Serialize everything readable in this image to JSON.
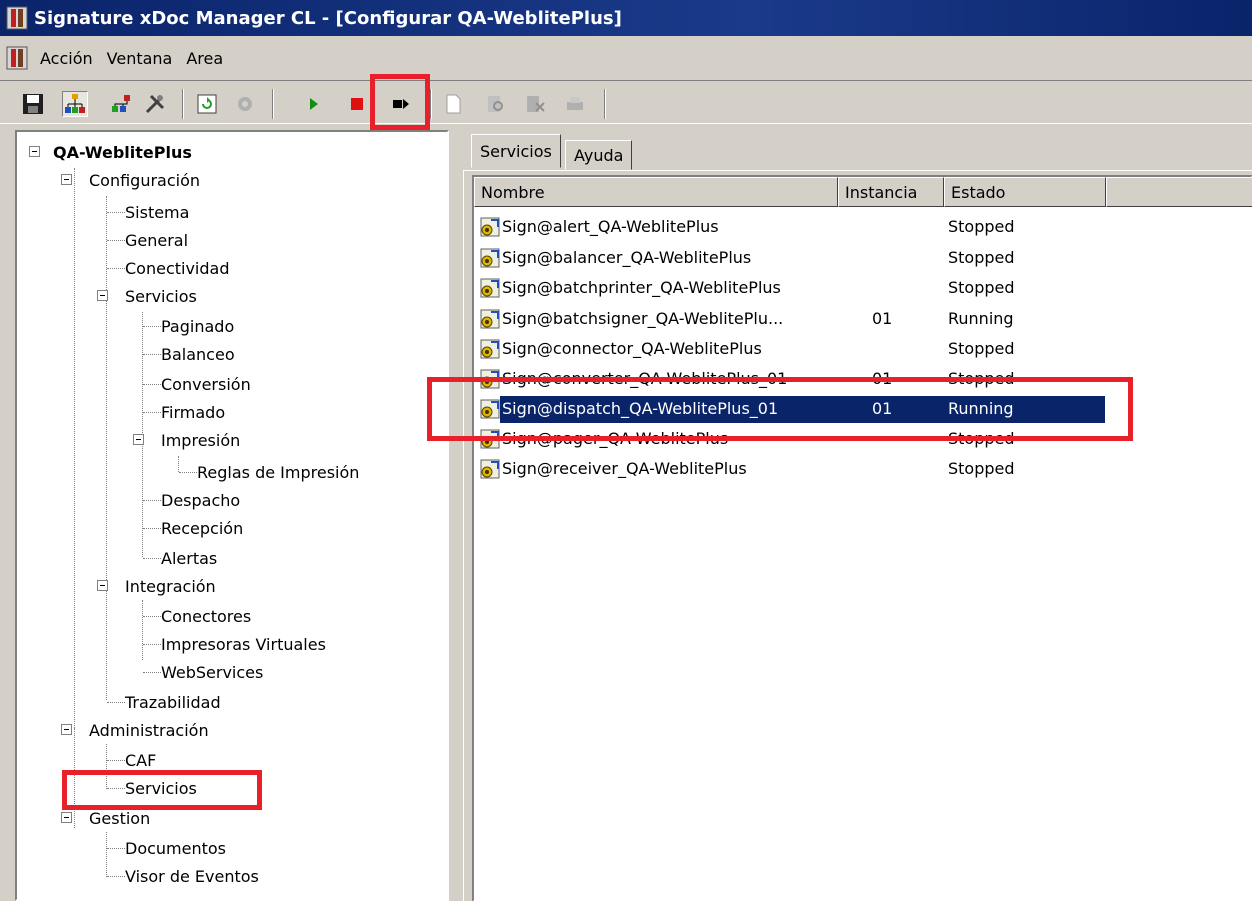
{
  "window": {
    "title": "Signature xDoc Manager CL - [Configurar QA-WeblitePlus]"
  },
  "menu": {
    "items": [
      "Acción",
      "Ventana",
      "Area"
    ]
  },
  "toolbar": {
    "buttons": [
      "save-icon",
      "config-tree-icon",
      "network-icon",
      "tools-icon",
      "refresh-icon",
      "gear-disabled-icon",
      "play-icon",
      "stop-icon",
      "stop-next-icon",
      "new-doc-icon",
      "doc-search-icon",
      "doc-flag-icon",
      "printer-icon"
    ]
  },
  "tree": {
    "root": "QA-WeblitePlus",
    "configuracion": "Configuración",
    "sistema": "Sistema",
    "general": "General",
    "conectividad": "Conectividad",
    "servicios": "Servicios",
    "paginado": "Paginado",
    "balanceo": "Balanceo",
    "conversion": "Conversión",
    "firmado": "Firmado",
    "impresion": "Impresión",
    "reglas": "Reglas de Impresión",
    "despacho": "Despacho",
    "recepcion": "Recepción",
    "alertas": "Alertas",
    "integracion": "Integración",
    "conectores": "Conectores",
    "impresoras": "Impresoras Virtuales",
    "webservices": "WebServices",
    "trazabilidad": "Trazabilidad",
    "administracion": "Administración",
    "caf": "CAF",
    "admin_servicios": "Servicios",
    "gestion": "Gestion",
    "documentos": "Documentos",
    "visor": "Visor de Eventos"
  },
  "tabs": {
    "servicios": "Servicios",
    "ayuda": "Ayuda"
  },
  "list": {
    "columns": {
      "nombre": "Nombre",
      "instancia": "Instancia",
      "estado": "Estado"
    },
    "rows": [
      {
        "name": "Sign@alert_QA-WeblitePlus",
        "instance": "",
        "state": "Stopped"
      },
      {
        "name": "Sign@balancer_QA-WeblitePlus",
        "instance": "",
        "state": "Stopped"
      },
      {
        "name": "Sign@batchprinter_QA-WeblitePlus",
        "instance": "",
        "state": "Stopped"
      },
      {
        "name": "Sign@batchsigner_QA-WeblitePlu...",
        "instance": "01",
        "state": "Running"
      },
      {
        "name": "Sign@connector_QA-WeblitePlus",
        "instance": "",
        "state": "Stopped"
      },
      {
        "name": "Sign@converter_QA-WeblitePlus_01",
        "instance": "01",
        "state": "Stopped"
      },
      {
        "name": "Sign@dispatch_QA-WeblitePlus_01",
        "instance": "01",
        "state": "Running"
      },
      {
        "name": "Sign@pager_QA-WeblitePlus",
        "instance": "",
        "state": "Stopped"
      },
      {
        "name": "Sign@receiver_QA-WeblitePlus",
        "instance": "",
        "state": "Stopped"
      }
    ],
    "selected_index": 6
  },
  "colors": {
    "titlebar": "#0a246a",
    "selection": "#0a246a",
    "annotation": "#e8202a"
  }
}
